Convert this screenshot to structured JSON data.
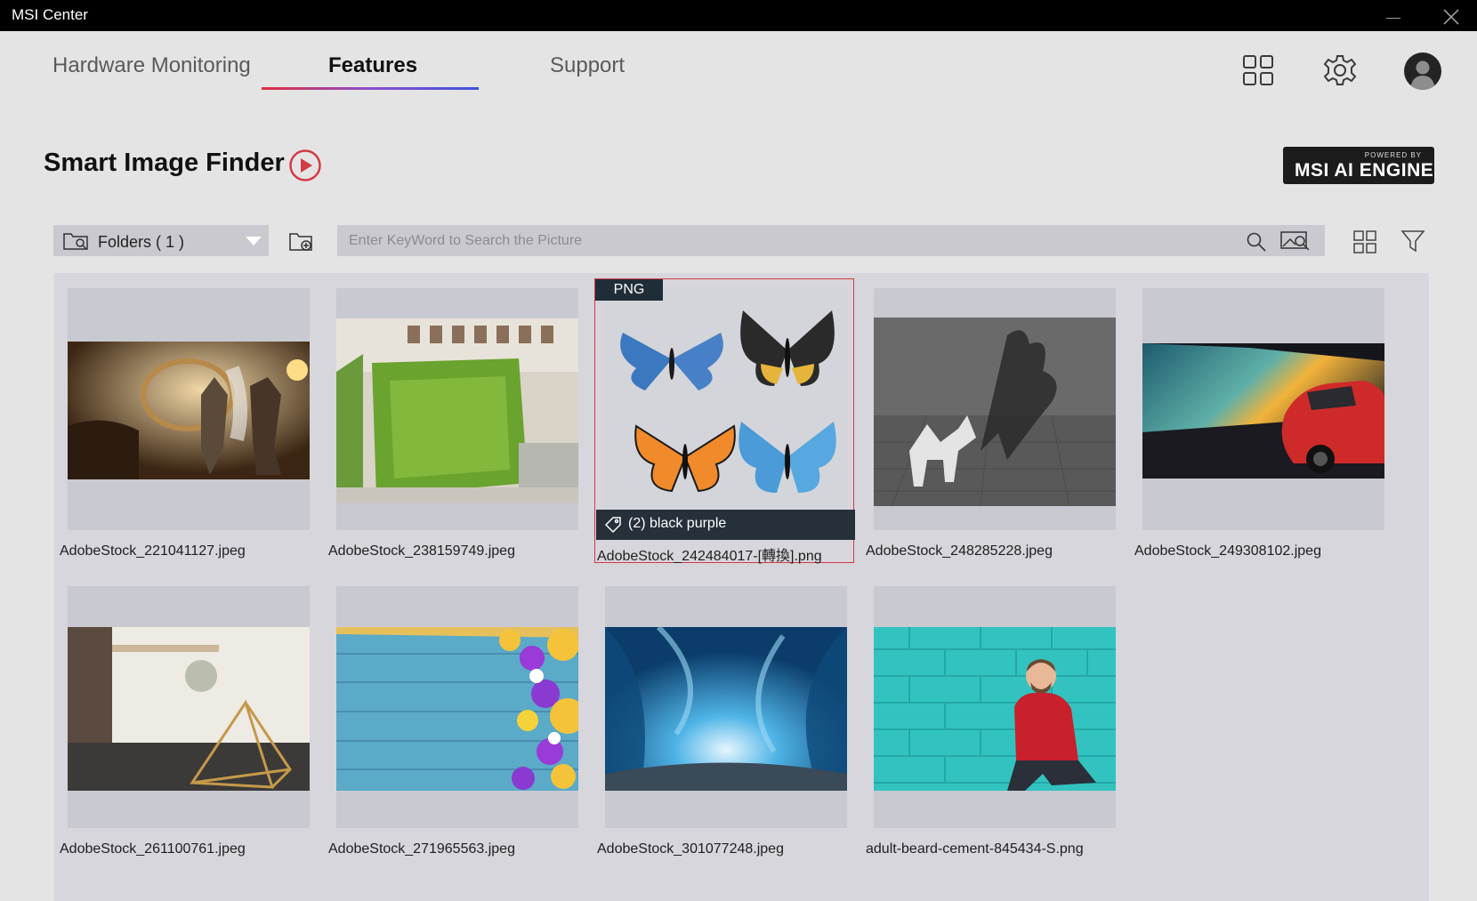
{
  "window": {
    "title": "MSI Center"
  },
  "tabs": [
    {
      "label": "Hardware Monitoring"
    },
    {
      "label": "Features"
    },
    {
      "label": "Support"
    }
  ],
  "page": {
    "title": "Smart Image Finder"
  },
  "ai_badge": {
    "powered_by": "POWERED BY",
    "engine": "MSI AI ENGINE"
  },
  "toolbar": {
    "folders_label": "Folders ( 1 )",
    "search_placeholder": "Enter KeyWord to Search the Picture"
  },
  "images": [
    {
      "filename": "AdobeStock_221041127.jpeg",
      "subject": "sci-fi soldiers in corridor"
    },
    {
      "filename": "AdobeStock_238159749.jpeg",
      "subject": "green wall building"
    },
    {
      "filename": "AdobeStock_242484017-[轉換].png",
      "subject": "four butterflies",
      "format_badge": "PNG",
      "tag": "(2) black  purple",
      "selected": true
    },
    {
      "filename": "AdobeStock_248285228.jpeg",
      "subject": "origami horse with pegasus shadow"
    },
    {
      "filename": "AdobeStock_249308102.jpeg",
      "subject": "red sports car at sunset"
    },
    {
      "filename": "AdobeStock_261100761.jpeg",
      "subject": "brass pyramid decor"
    },
    {
      "filename": "AdobeStock_271965563.jpeg",
      "subject": "flowers on blue wood"
    },
    {
      "filename": "AdobeStock_301077248.jpeg",
      "subject": "ice cave"
    },
    {
      "filename": "adult-beard-cement-845434-S.png",
      "subject": "man in red sweater at teal wall"
    }
  ],
  "colors": {
    "accent_red": "#d23a45",
    "underline_start": "#e02d3c",
    "underline_end": "#3e52d8",
    "titlebar": "#000000"
  },
  "icons": [
    "close-icon",
    "minimize-icon",
    "apps-grid-icon",
    "gear-icon",
    "user-avatar-icon",
    "play-icon",
    "folder-icon",
    "add-folder-icon",
    "search-icon",
    "image-search-icon",
    "grid-view-icon",
    "filter-icon",
    "tag-icon"
  ]
}
